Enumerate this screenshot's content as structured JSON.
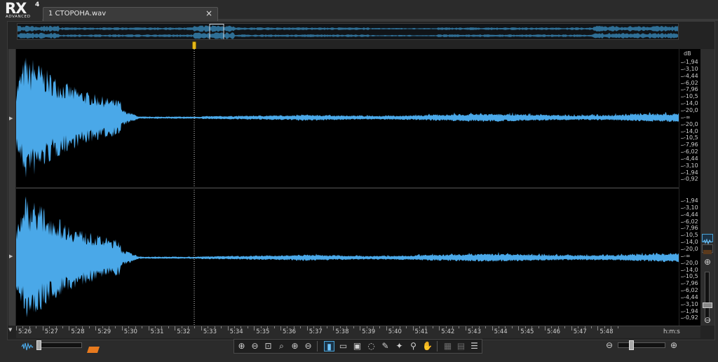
{
  "app": {
    "logo_text": "RX",
    "logo_version": "4",
    "logo_edition": "ADVANCED"
  },
  "tab": {
    "label": "1 СТОРОНА.wav",
    "close_glyph": "×"
  },
  "db_scale": {
    "unit": "dB",
    "upper_labels": [
      "-1,94",
      "-3,10",
      "-4,44",
      "-6,02",
      "-7,96",
      "-10,5",
      "-14,0",
      "-20,0",
      "-∞",
      "-20,0",
      "-14,0",
      "-10,5",
      "-7,96",
      "-6,02",
      "-4,44",
      "-3,10",
      "-1,94",
      "-0,92"
    ],
    "lower_labels": [
      "-1,94",
      "-3,10",
      "-4,44",
      "-6,02",
      "-7,96",
      "-10,5",
      "-14,0",
      "-20,0",
      "-∞",
      "-20,0",
      "-14,0",
      "-10,5",
      "-7,96",
      "-6,02",
      "-4,44",
      "-3,10",
      "-1,94",
      "-0,92"
    ]
  },
  "timeline": {
    "labels": [
      "5:26",
      "5:27",
      "5:28",
      "5:29",
      "5:30",
      "5:31",
      "5:32",
      "5:33",
      "5:34",
      "5:35",
      "5:36",
      "5:37",
      "5:38",
      "5:39",
      "5:40",
      "5:41",
      "5:42",
      "5:43",
      "5:44",
      "5:45",
      "5:46",
      "5:47",
      "5:48"
    ],
    "unit_label": "h:m:s"
  },
  "playhead_time": "5:31.5",
  "colors": {
    "waveform": "#4aa8e8",
    "background": "#000000",
    "accent": "#4aa3d8",
    "playhead": "#e5b719",
    "spectrogram_button": "#e87a1e"
  },
  "icons": {
    "zoom_tools": [
      "zoom-in-icon",
      "zoom-out-icon",
      "zoom-fit-icon",
      "zoom-selection-icon",
      "zoom-in-vertical-icon",
      "zoom-out-vertical-icon"
    ],
    "selection_tools": [
      "time-selection-icon",
      "freq-selection-icon",
      "time-freq-selection-icon",
      "lasso-icon",
      "brush-icon",
      "magic-wand-icon",
      "find-similar-icon",
      "hand-icon"
    ],
    "extra_tools": [
      "spectral-grid-icon",
      "harmonic-icon",
      "instant-process-icon"
    ]
  }
}
